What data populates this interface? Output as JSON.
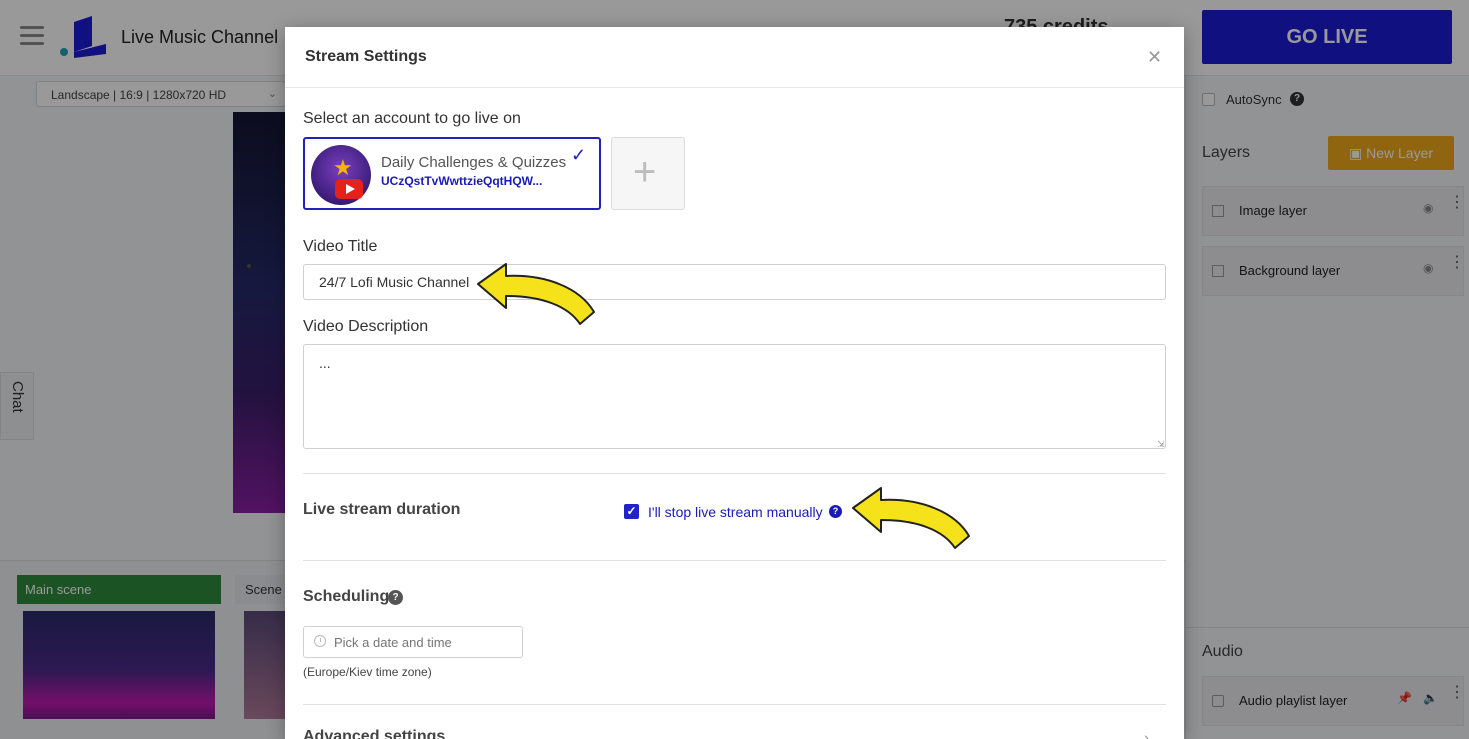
{
  "app": {
    "title": "Live Music Channel",
    "credits": "735 credits",
    "go_live_label": "GO LIVE",
    "format_select": "Landscape | 16:9 | 1280x720 HD",
    "chat_label": "Chat"
  },
  "scenes": {
    "main_label": "Main scene",
    "second_label": "Scene"
  },
  "right_panel": {
    "autosync_label": "AutoSync",
    "layers_title": "Layers",
    "new_layer_label": "New Layer",
    "layers": [
      {
        "label": "Image layer"
      },
      {
        "label": "Background layer"
      }
    ],
    "audio_title": "Audio",
    "audio_layer_label": "Audio playlist layer"
  },
  "modal": {
    "title": "Stream Settings",
    "account_prompt": "Select an account to go live on",
    "account": {
      "name": "Daily Challenges & Quizzes",
      "channel_id": "UCzQstTvWwttzieQqtHQW..."
    },
    "video_title_label": "Video Title",
    "video_title_value": "24/7 Lofi Music Channel",
    "video_description_label": "Video Description",
    "video_description_value": "...",
    "duration_label": "Live stream duration",
    "manual_stop_label": "I'll stop live stream manually",
    "manual_stop_checked": true,
    "scheduling_label": "Scheduling",
    "date_placeholder": "Pick a date and time",
    "timezone_note": "(Europe/Kiev time zone)",
    "advanced_label": "Advanced settings"
  },
  "colors": {
    "accent": "#2222bb",
    "go_live": "#1c1cd6",
    "new_layer": "#f0a81c",
    "main_scene": "#2e8b3c",
    "annotation_arrow": "#f6e21a"
  }
}
